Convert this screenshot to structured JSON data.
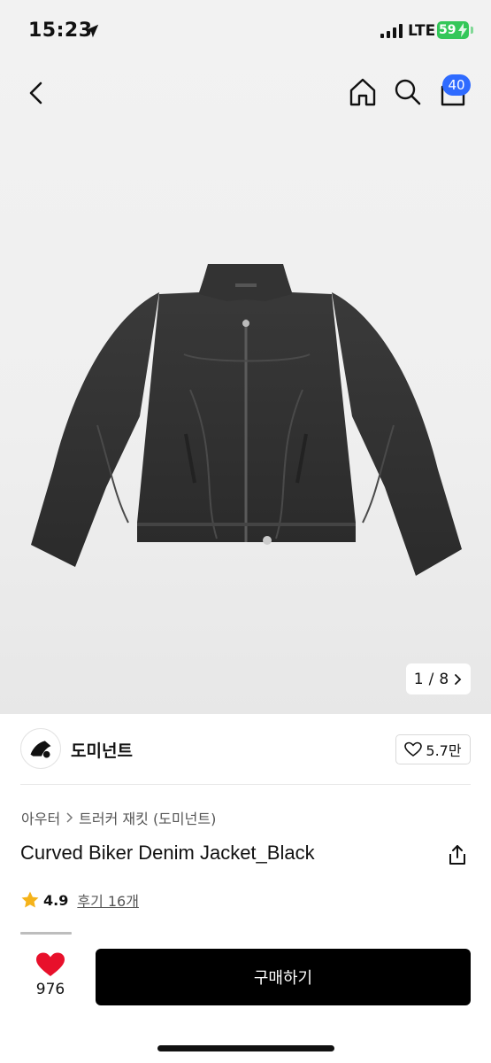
{
  "status_bar": {
    "time": "15:23",
    "network": "LTE",
    "battery": "59"
  },
  "nav": {
    "cart_count": "40"
  },
  "gallery": {
    "current": "1",
    "separator": "/",
    "total": "8"
  },
  "brand": {
    "name": "도미넌트",
    "likes": "5.7만"
  },
  "breadcrumb": {
    "category": "아우터",
    "subcategory": "트러커 재킷 (도미넌트)"
  },
  "product": {
    "name": "Curved Biker Denim Jacket_Black"
  },
  "rating": {
    "score": "4.9",
    "reviews_label": "후기 16개"
  },
  "bottom_bar": {
    "favorite_count": "976",
    "buy_label": "구매하기"
  },
  "colors": {
    "accent_blue": "#2f6bff",
    "heart_red": "#e8102b",
    "star_gold": "#f5b31a",
    "battery_green": "#34c759"
  }
}
